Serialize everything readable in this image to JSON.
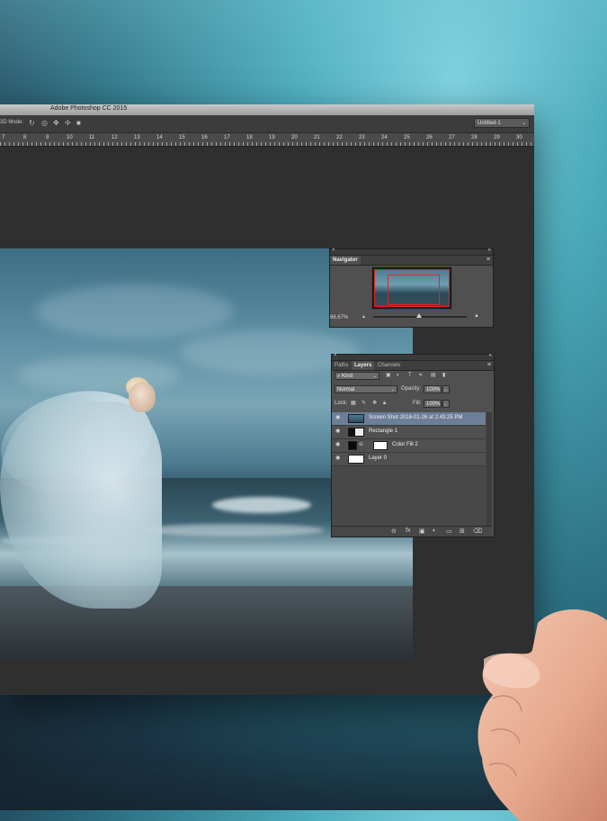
{
  "window": {
    "title": "Adobe Photoshop CC 2015",
    "mode_label": "3D Mode:",
    "document_select": "Untitled-1"
  },
  "ruler": {
    "ticks": [
      "7",
      "8",
      "9",
      "10",
      "11",
      "12",
      "13",
      "14",
      "15",
      "16",
      "17",
      "18",
      "19",
      "20",
      "21",
      "22",
      "23",
      "24",
      "25",
      "26",
      "27",
      "28",
      "29",
      "30"
    ]
  },
  "navigator": {
    "tab": "Navigator",
    "zoom": "66.67%",
    "frame_color": "#e8221f"
  },
  "layers_panel": {
    "tabs": [
      "Paths",
      "Layers",
      "Channels"
    ],
    "active_tab": "Layers",
    "filter": "Kind",
    "blend_mode": "Normal",
    "opacity_label": "Opacity:",
    "opacity_value": "100%",
    "lock_label": "Lock:",
    "fill_label": "Fill:",
    "fill_value": "100%",
    "layers": [
      {
        "name": "Screen Shot 2016-01-26 at 2.43.25 PM",
        "selected": true
      },
      {
        "name": "Rectangle 1",
        "selected": false
      },
      {
        "name": "Color Fill 2",
        "selected": false
      },
      {
        "name": "Layer 0",
        "selected": false
      }
    ],
    "selection_color": "#6c7e98"
  },
  "icons": {
    "close": "×",
    "collapse": "«",
    "panel_menu": "≡",
    "eye": "◉",
    "link": "⊖",
    "fx": "fx",
    "mask": "▣",
    "adjust": "◐",
    "folder": "▭",
    "new_layer": "⊞",
    "trash": "⌫",
    "chevron": "⌄"
  }
}
